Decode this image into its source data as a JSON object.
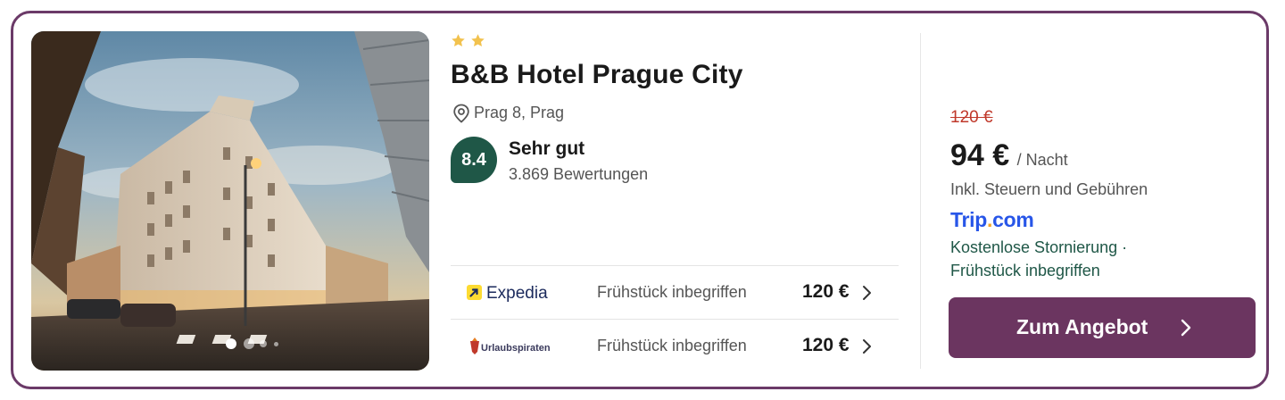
{
  "hotel": {
    "name": "B&B Hotel Prague City",
    "stars": 2,
    "location": "Prag 8, Prag",
    "rating": {
      "score": "8.4",
      "label": "Sehr gut",
      "reviews": "3.869 Bewertungen"
    },
    "photo": {
      "icon": "hotel-photo",
      "carousel_dots": 4,
      "active_dot": 1
    }
  },
  "offers": [
    {
      "provider": "Expedia",
      "meal": "Frühstück inbegriffen",
      "price": "120 €",
      "logo_icon": "expedia-logo"
    },
    {
      "provider": "Urlaubspiraten",
      "meal": "Frühstück inbegriffen",
      "price": "120 €",
      "logo_icon": "urlaubspiraten-logo"
    }
  ],
  "deal": {
    "old_price": "120 €",
    "price": "94 €",
    "unit": "/ Nacht",
    "note": "Inkl. Steuern und Gebühren",
    "provider_name": "Trip",
    "provider_dot": ".",
    "provider_tld": "com",
    "perk_line1": "Kostenlose Stornierung ·",
    "perk_line2": "Frühstück inbegriffen",
    "cta_label": "Zum Angebot"
  },
  "colors": {
    "border": "#6b3a68",
    "cta": "#6b3560",
    "rating_badge": "#1f5747",
    "star": "#f2c24e",
    "old_price": "#c0392b",
    "provider": "#2856e8"
  }
}
